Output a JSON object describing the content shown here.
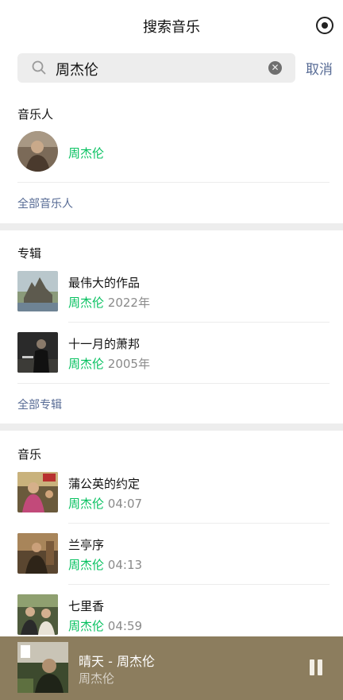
{
  "header": {
    "title": "搜索音乐",
    "target_icon": "target-icon"
  },
  "search": {
    "query": "周杰伦",
    "cancel": "取消",
    "search_icon": "search-icon",
    "clear_icon": "clear-icon"
  },
  "artists": {
    "title": "音乐人",
    "items": [
      {
        "name": "周杰伦"
      }
    ],
    "more": "全部音乐人"
  },
  "albums": {
    "title": "专辑",
    "items": [
      {
        "title": "最伟大的作品",
        "artist": "周杰伦",
        "meta": "2022年"
      },
      {
        "title": "十一月的萧邦",
        "artist": "周杰伦",
        "meta": "2005年"
      }
    ],
    "more": "全部专辑"
  },
  "songs": {
    "title": "音乐",
    "items": [
      {
        "title": "蒲公英的约定",
        "artist": "周杰伦",
        "meta": "04:07"
      },
      {
        "title": "兰亭序",
        "artist": "周杰伦",
        "meta": "04:13"
      },
      {
        "title": "七里香",
        "artist": "周杰伦",
        "meta": "04:59"
      }
    ]
  },
  "player": {
    "title": "晴天 - 周杰伦",
    "artist": "周杰伦",
    "pause_icon": "pause-icon"
  },
  "colors": {
    "accent_green": "#07c160",
    "link_blue": "#576b95",
    "player_bg": "#8c7d5e"
  }
}
